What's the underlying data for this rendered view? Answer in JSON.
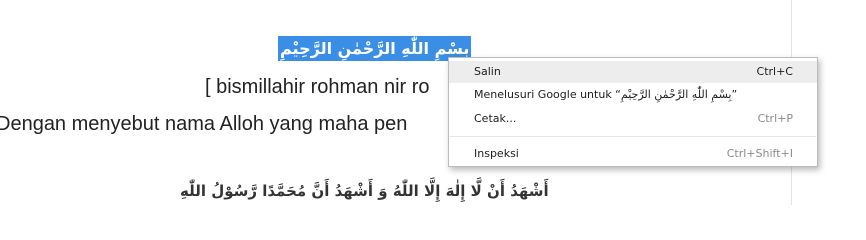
{
  "document": {
    "arabic_selected": "بِسْمِ اللّٰهِ الرَّحْمٰنِ الرَّحِيْمِ",
    "transliteration": "[ bismillahir rohman nir ro",
    "meaning": "Dengan menyebut nama Alloh yang maha pen",
    "shahada": "أَشْهَدُ أَنْ لَّا إِلٰهَ إِلَّا اللّٰهُ وَ أَشْهَدُ أَنَّ مُحَمَّدًا رَّسُوْلُ اللّٰهِ"
  },
  "context_menu": {
    "items": [
      {
        "label": "Salin",
        "shortcut": "Ctrl+C"
      },
      {
        "label": "Menelusuri Google untuk “بِسْمِ اللّٰهِ الرَّحْمٰنِ الرَّحِيْمِ”",
        "shortcut": ""
      },
      {
        "label": "Cetak...",
        "shortcut": "Ctrl+P"
      },
      {
        "label": "Inspeksi",
        "shortcut": "Ctrl+Shift+I"
      }
    ]
  }
}
